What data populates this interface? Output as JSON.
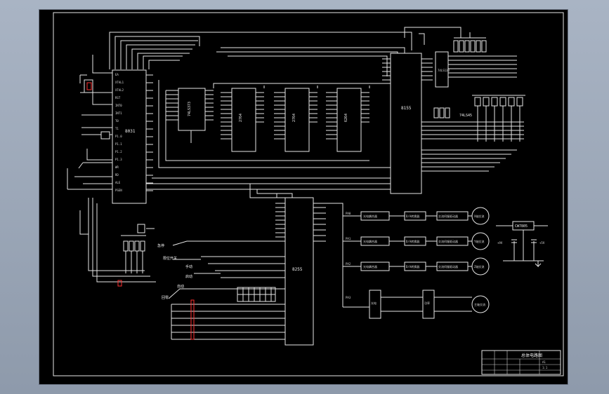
{
  "colors": {
    "backdrop": "#a9b4c4",
    "sheet": "#000000",
    "line": "#e6e6e6",
    "accent_red": "#ff3030"
  },
  "chips": {
    "cpu": "8031",
    "latch": "74LS373",
    "eprom": "2764",
    "ram1": "2764",
    "ram2": "6264",
    "ppi": "8155",
    "decoder": "74LS138",
    "display_driver": "74LS45",
    "dac": "8255"
  },
  "cpu_pins": [
    "EA",
    "XTAL1",
    "XTAL2",
    "RST",
    "INT0",
    "INT1",
    "T0",
    "T1",
    "P1.0",
    "P1.1",
    "P1.2",
    "P1.3",
    "WR",
    "RD",
    "ALE",
    "PSEN"
  ],
  "channels": [
    {
      "port": "PA0",
      "amp": "光电耦合器",
      "driver": "D/A转换器",
      "stage": "交流伺服驱动器",
      "motor": "X轴交流伺服电动机"
    },
    {
      "port": "PA1",
      "amp": "光电耦合器",
      "driver": "D/A转换器",
      "stage": "交流伺服驱动器",
      "motor": "Y轴交流伺服电动机"
    },
    {
      "port": "PA2",
      "amp": "光电耦合器",
      "driver": "D/A转换器",
      "stage": "交流伺服驱动器",
      "motor": "Z轴交流伺服电动机"
    },
    {
      "port": "PA3",
      "amp": "光电耦合器",
      "driver": "功率放大",
      "stage": "交流伺服驱动器",
      "motor": "主轴交流伺服电动机"
    }
  ],
  "switches": [
    "急停",
    "限位开关",
    "手动",
    "自动",
    "回零",
    "启动"
  ],
  "power": {
    "regulator": "CW7805",
    "in_label": "+9V",
    "out_label": "+5V"
  },
  "title_block": {
    "title": "总体电路图",
    "drawing_no": "A1",
    "scale": "1:1"
  }
}
